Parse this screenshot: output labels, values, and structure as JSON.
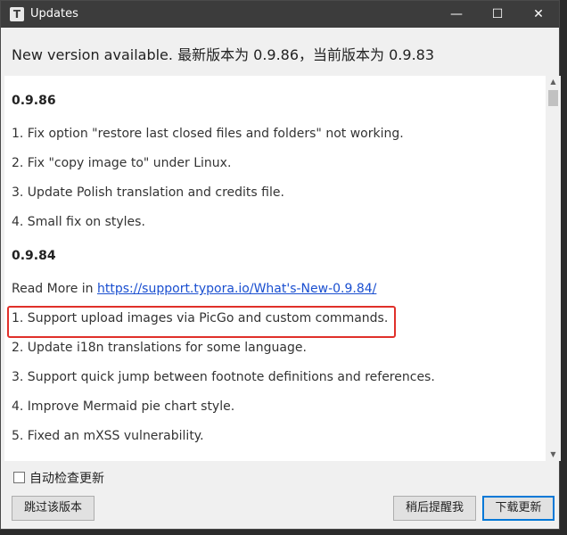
{
  "window": {
    "title": "Updates",
    "app_icon_letter": "T",
    "minimize_glyph": "—",
    "maximize_glyph": "☐",
    "close_glyph": "✕"
  },
  "header": {
    "message": "New version available. 最新版本为 0.9.86，当前版本为 0.9.83"
  },
  "release_notes": {
    "v0986_heading": "0.9.86",
    "v0986_items": [
      "1. Fix option \"restore last closed files and folders\" not working.",
      "2. Fix \"copy image to\" under Linux.",
      "3. Update Polish translation and credits file.",
      "4. Small fix on styles."
    ],
    "v0984_heading": "0.9.84",
    "read_more_label": "Read More in ",
    "read_more_link": "https://support.typora.io/What's-New-0.9.84/",
    "v0984_items": [
      "1. Support upload images via PicGo and custom commands.",
      "2. Update i18n translations for some language.",
      "3. Support quick jump between footnote definitions and references.",
      "4. Improve Mermaid pie chart style.",
      "5. Fixed an mXSS vulnerability."
    ]
  },
  "options": {
    "auto_check_label": "自动检查更新",
    "auto_check_checked": false
  },
  "buttons": {
    "skip_label": "跳过该版本",
    "later_label": "稍后提醒我",
    "download_label": "下载更新"
  },
  "colors": {
    "highlight": "#e0302a",
    "link": "#1a4fd0",
    "titlebar": "#3c3c3c",
    "primary_button_border": "#0078d7"
  }
}
